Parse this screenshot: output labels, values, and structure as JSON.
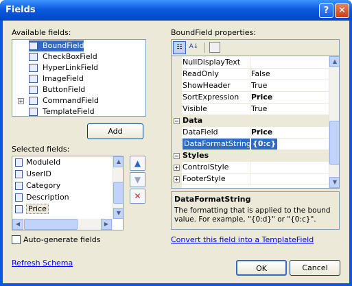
{
  "window": {
    "title": "Fields",
    "help_glyph": "?",
    "close_glyph": "✕"
  },
  "available": {
    "label": "Available fields:",
    "items": [
      "BoundField",
      "CheckBoxField",
      "HyperLinkField",
      "ImageField",
      "ButtonField",
      "CommandField",
      "TemplateField"
    ],
    "add_label": "Add"
  },
  "selected": {
    "label": "Selected fields:",
    "items": [
      "ModuleId",
      "UserID",
      "Category",
      "Description",
      "Price"
    ],
    "up_glyph": "▲",
    "down_glyph": "▼",
    "delete_glyph": "✕"
  },
  "autogen": {
    "label": "Auto-generate fields"
  },
  "refresh_link": "Refresh Schema",
  "properties": {
    "label": "BoundField properties:",
    "rows": [
      {
        "type": "prop",
        "name": "NullDisplayText",
        "value": ""
      },
      {
        "type": "prop",
        "name": "ReadOnly",
        "value": "False"
      },
      {
        "type": "prop",
        "name": "ShowHeader",
        "value": "True"
      },
      {
        "type": "prop",
        "name": "SortExpression",
        "value": "Price"
      },
      {
        "type": "prop",
        "name": "Visible",
        "value": "True"
      },
      {
        "type": "cat",
        "name": "Data"
      },
      {
        "type": "prop",
        "name": "DataField",
        "value": "Price"
      },
      {
        "type": "prop",
        "name": "DataFormatString",
        "value": "{0:c}"
      },
      {
        "type": "cat",
        "name": "Styles"
      },
      {
        "type": "prop",
        "name": "ControlStyle",
        "value": ""
      },
      {
        "type": "prop",
        "name": "FooterStyle",
        "value": ""
      }
    ],
    "desc_title": "DataFormatString",
    "desc_text": "The formatting that is applied to the bound value. For example, \"{0:d}\" or \"{0:c}\"."
  },
  "convert_link": "Convert this field into a TemplateField",
  "ok_label": "OK",
  "cancel_label": "Cancel",
  "colors": {
    "title_bar": "#0a5bde",
    "dialog_bg": "#ece9d8",
    "selection": "#316ac5",
    "link": "#0000ff"
  }
}
